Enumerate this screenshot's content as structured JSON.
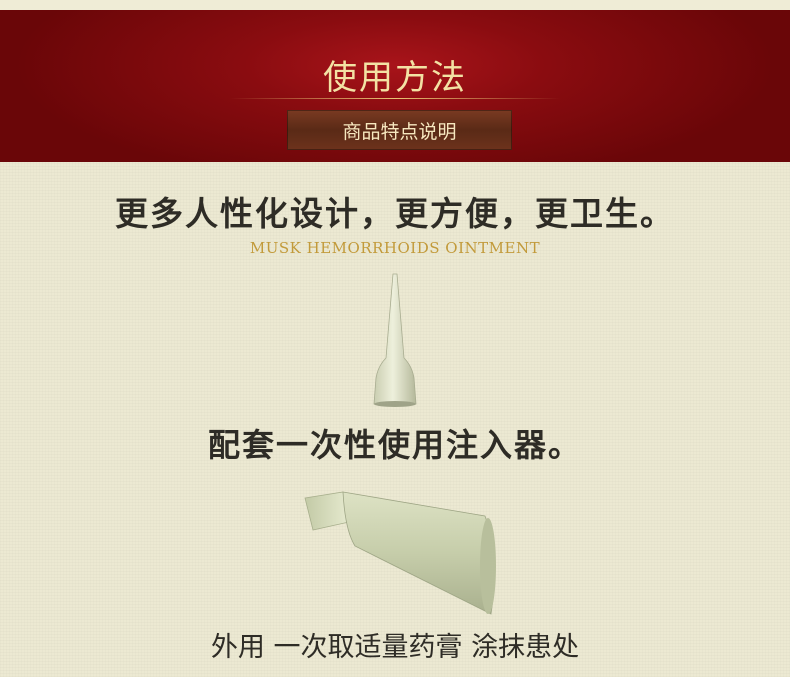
{
  "header": {
    "title": "使用方法",
    "tab_label": "商品特点说明"
  },
  "features": {
    "headline": "更多人性化设计，更方便，更卫生。",
    "subtitle": "MUSK HEMORRHOIDS OINTMENT",
    "applicator_caption": "配套一次性使用注入器。",
    "instruction": "外用 一次取适量药膏 涂抹患处"
  },
  "colors": {
    "header_red": "#8a0c10",
    "gold_text": "#c29a3a",
    "title_text": "#f3e2a4",
    "background": "#ece9d2"
  }
}
